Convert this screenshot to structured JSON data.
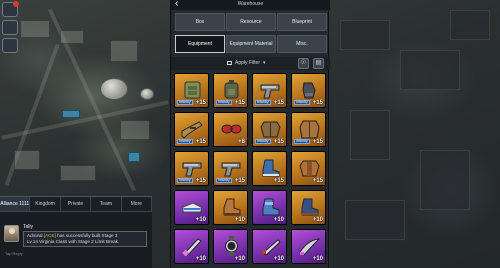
{
  "panel": {
    "title": "Warehouse",
    "tabs": [
      "Box",
      "Resource",
      "Blueprint",
      "Equipment",
      "Equipment Material",
      "Misc."
    ],
    "active_tab": "Equipment",
    "filter_label": "Apply Filter"
  },
  "items": [
    {
      "icon": "tactical-vest-icon",
      "rarity": "gold",
      "count": "+15",
      "badge": "Infantry"
    },
    {
      "icon": "backpack-icon",
      "rarity": "gold",
      "count": "+15",
      "badge": "Infantry"
    },
    {
      "icon": "pistol-icon",
      "rarity": "gold",
      "count": "+15",
      "badge": "Infantry"
    },
    {
      "icon": "gloves-icon",
      "rarity": "gold",
      "count": "+15",
      "badge": "Infantry"
    },
    {
      "icon": "rifle-icon",
      "rarity": "gold",
      "count": "+15",
      "badge": "Infantry"
    },
    {
      "icon": "goggles-icon",
      "rarity": "gold",
      "count": "+8",
      "badge": ""
    },
    {
      "icon": "jacket-icon",
      "rarity": "gold",
      "count": "+15",
      "badge": "Infantry"
    },
    {
      "icon": "coat-icon",
      "rarity": "gold",
      "count": "+15",
      "badge": "Infantry"
    },
    {
      "icon": "pistol-icon",
      "rarity": "gold",
      "count": "+15",
      "badge": "Infantry"
    },
    {
      "icon": "pistol-icon",
      "rarity": "gold",
      "count": "+15",
      "badge": "Infantry"
    },
    {
      "icon": "boots-icon",
      "rarity": "gold",
      "count": "+15",
      "badge": ""
    },
    {
      "icon": "leather-jacket-icon",
      "rarity": "gold",
      "count": "+15",
      "badge": ""
    },
    {
      "icon": "sneaker-icon",
      "rarity": "purple",
      "count": "+10",
      "badge": ""
    },
    {
      "icon": "leather-boot-icon",
      "rarity": "gold",
      "count": "+10",
      "badge": ""
    },
    {
      "icon": "armor-boot-icon",
      "rarity": "purple",
      "count": "+10",
      "badge": ""
    },
    {
      "icon": "combat-boot-icon",
      "rarity": "gold",
      "count": "+10",
      "badge": ""
    },
    {
      "icon": "knife-icon",
      "rarity": "purple",
      "count": "+10",
      "badge": ""
    },
    {
      "icon": "wristwatch-icon",
      "rarity": "purple",
      "count": "+10",
      "badge": ""
    },
    {
      "icon": "dagger-icon",
      "rarity": "purple",
      "count": "+10",
      "badge": ""
    },
    {
      "icon": "blade-icon",
      "rarity": "purple",
      "count": "+10",
      "badge": ""
    }
  ],
  "chat": {
    "tabs": [
      "Alliance 1111",
      "Kingdom",
      "Private",
      "Team",
      "More"
    ],
    "active_tab": 0,
    "sender": "Tally",
    "message_prefix": "Admiral",
    "message_tag": "[ACE]",
    "message_body": " has successfully built Stage 3",
    "message_line2": "Lv.14 Virginia Class with Stage 2 Limit Break.",
    "hint": "Tap Reply"
  },
  "colors": {
    "gold_rarity": "#c98a28",
    "purple_rarity": "#8a3bbf",
    "panel_bg": "#24292e",
    "active_tab_border": "#c7ccd0"
  }
}
